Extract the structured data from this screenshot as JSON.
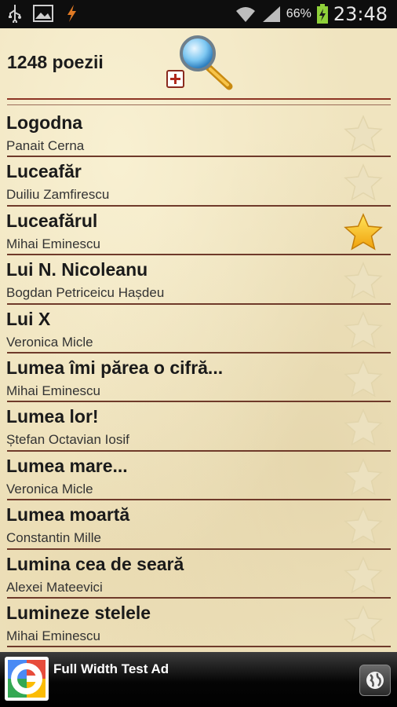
{
  "status_bar": {
    "battery_pct": "66%",
    "time": "23:48",
    "icons": [
      "usb-icon",
      "image-icon",
      "flash-icon",
      "wifi-icon",
      "signal-icon",
      "battery-charging-icon"
    ]
  },
  "header": {
    "count_label": "1248 poezii",
    "search_icon": "magnifier-add-icon"
  },
  "poems": [
    {
      "title": "Logodna",
      "author": "Panait Cerna",
      "favorite": false
    },
    {
      "title": "Luceafăr",
      "author": "Duiliu Zamfirescu",
      "favorite": false
    },
    {
      "title": "Luceafărul",
      "author": "Mihai Eminescu",
      "favorite": true
    },
    {
      "title": "Lui N. Nicoleanu",
      "author": "Bogdan Petriceicu Hașdeu",
      "favorite": false
    },
    {
      "title": "Lui X",
      "author": "Veronica Micle",
      "favorite": false
    },
    {
      "title": "Lumea îmi părea o cifră...",
      "author": "Mihai Eminescu",
      "favorite": false
    },
    {
      "title": "Lumea lor!",
      "author": "Ștefan Octavian Iosif",
      "favorite": false
    },
    {
      "title": "Lumea mare...",
      "author": "Veronica Micle",
      "favorite": false
    },
    {
      "title": "Lumea moartă",
      "author": "Constantin Mille",
      "favorite": false
    },
    {
      "title": "Lumina cea de seară",
      "author": "Alexei Mateevici",
      "favorite": false
    },
    {
      "title": "Lumineze stelele",
      "author": "Mihai Eminescu",
      "favorite": false
    }
  ],
  "ad": {
    "text": "Full Width Test Ad",
    "logo_icon": "google-logo-icon",
    "action_icon": "globe-icon"
  },
  "colors": {
    "paper": "#f0e4bf",
    "divider": "#6f3a2a",
    "star_active": "#f7b71a",
    "star_inactive": "#e9dcb7"
  }
}
